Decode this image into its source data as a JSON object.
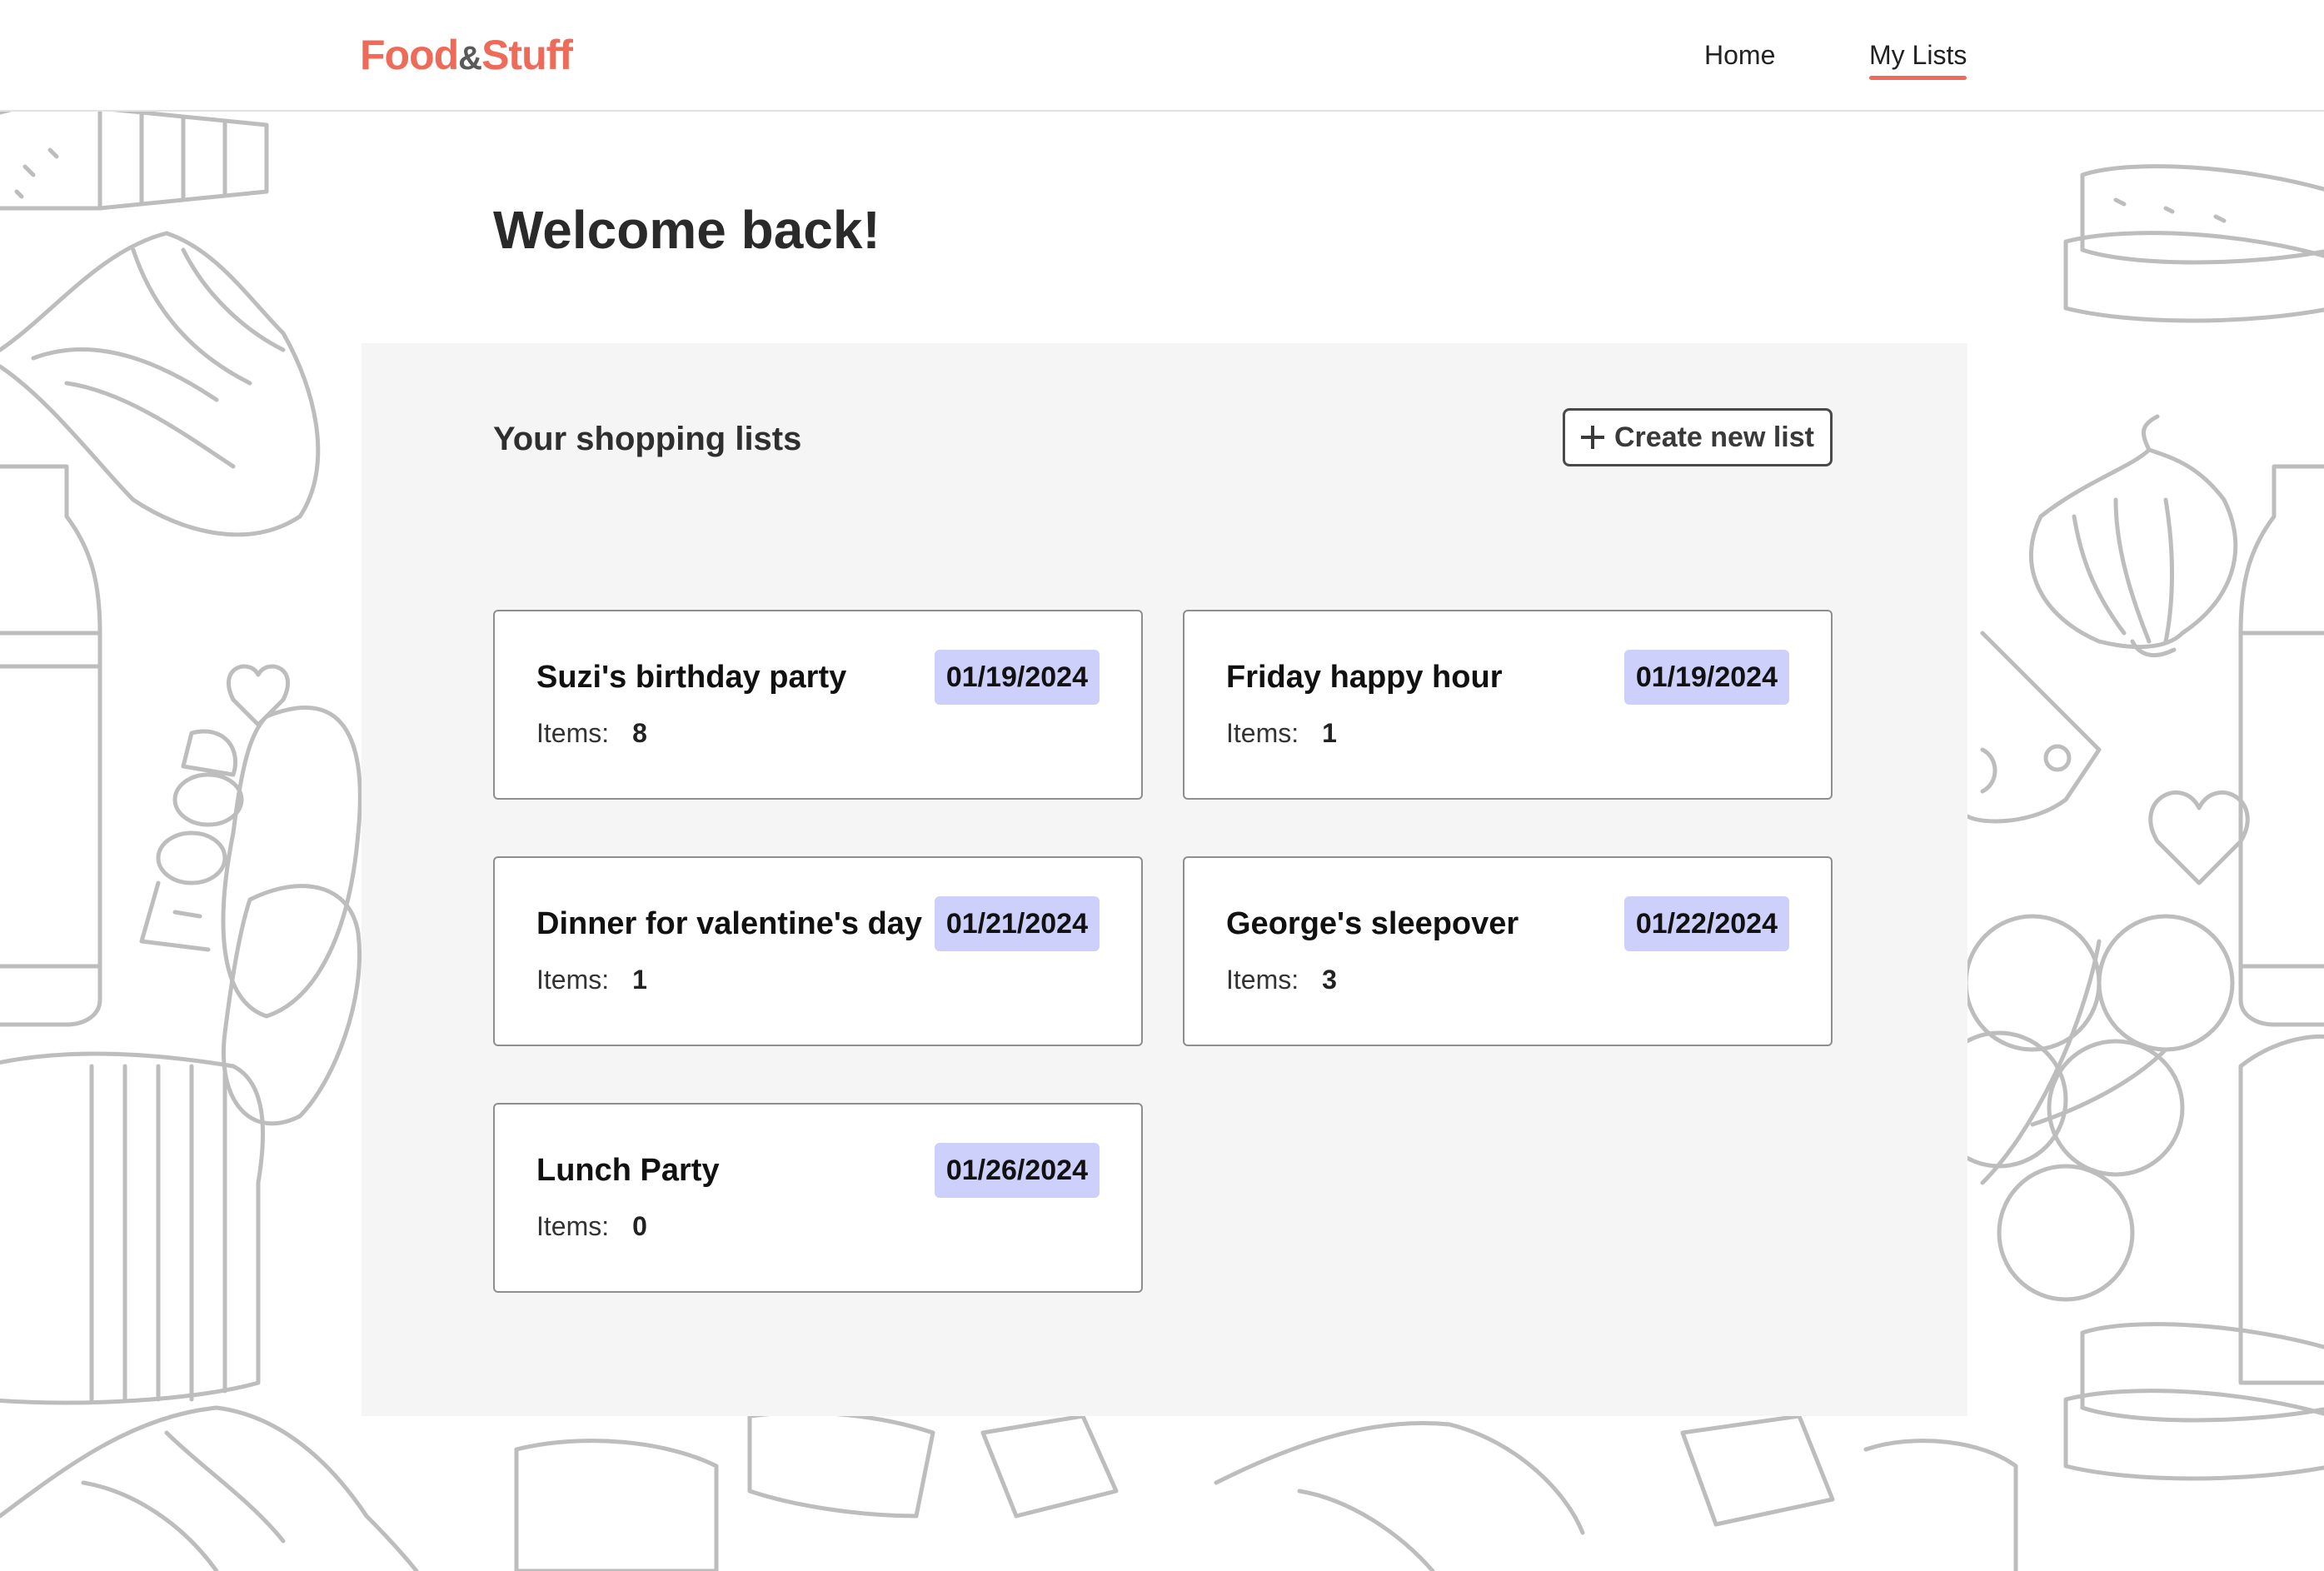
{
  "header": {
    "brand": {
      "part1": "Food",
      "part2": "&",
      "part3": "Stuff"
    },
    "nav": [
      {
        "label": "Home",
        "active": false
      },
      {
        "label": "My Lists",
        "active": true
      }
    ]
  },
  "main": {
    "welcome": "Welcome back!",
    "section_title": "Your shopping lists",
    "create_button_label": "Create new list",
    "items_label": "Items:",
    "lists": [
      {
        "title": "Suzi's birthday party",
        "date": "01/19/2024",
        "items": "8"
      },
      {
        "title": "Friday happy hour",
        "date": "01/19/2024",
        "items": "1"
      },
      {
        "title": "Dinner for valentine's day",
        "date": "01/21/2024",
        "items": "1"
      },
      {
        "title": "George's sleepover",
        "date": "01/22/2024",
        "items": "3"
      },
      {
        "title": "Lunch Party",
        "date": "01/26/2024",
        "items": "0"
      }
    ]
  },
  "colors": {
    "brand": "#ee6b5a",
    "date_badge": "#cdd0fb",
    "section_bg": "#f5f5f5",
    "doodle_stroke": "#bdbdbd"
  }
}
